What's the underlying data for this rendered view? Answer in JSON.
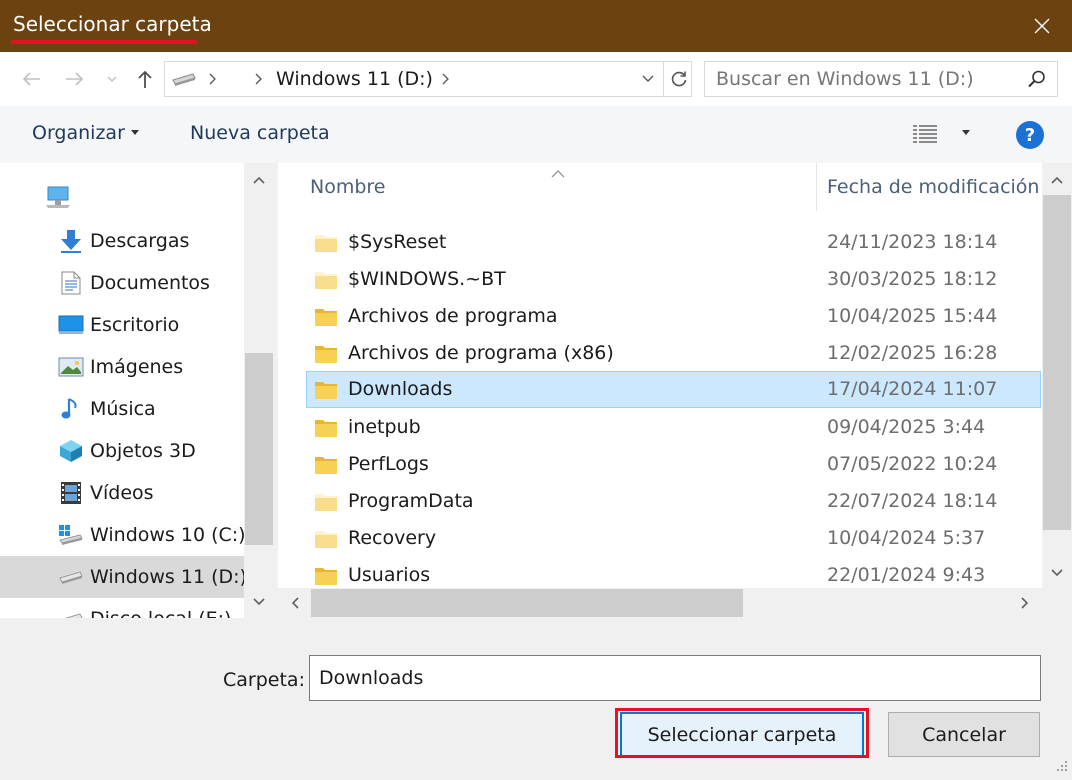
{
  "window": {
    "title": "Seleccionar carpeta"
  },
  "address": {
    "path": "Windows 11 (D:)"
  },
  "search": {
    "placeholder": "Buscar en Windows 11 (D:)"
  },
  "toolbar": {
    "organize_label": "Organizar",
    "new_folder_label": "Nueva carpeta",
    "help_label": "?"
  },
  "nav": {
    "items": [
      {
        "label": "Descargas",
        "icon": "downloads-icon"
      },
      {
        "label": "Documentos",
        "icon": "documents-icon"
      },
      {
        "label": "Escritorio",
        "icon": "desktop-icon"
      },
      {
        "label": "Imágenes",
        "icon": "pictures-icon"
      },
      {
        "label": "Música",
        "icon": "music-icon"
      },
      {
        "label": "Objetos 3D",
        "icon": "3d-objects-icon"
      },
      {
        "label": "Vídeos",
        "icon": "videos-icon"
      },
      {
        "label": "Windows 10 (C:)",
        "icon": "windows-drive-icon"
      },
      {
        "label": "Windows 11 (D:)",
        "icon": "drive-icon",
        "selected": true
      },
      {
        "label": "Disco local (E:)",
        "icon": "drive-icon"
      }
    ]
  },
  "columns": {
    "name": "Nombre",
    "date": "Fecha de modificación"
  },
  "files": [
    {
      "name": "$SysReset",
      "date": "24/11/2023 18:14"
    },
    {
      "name": "$WINDOWS.~BT",
      "date": "30/03/2025 18:12"
    },
    {
      "name": "Archivos de programa",
      "date": "10/04/2025 15:44"
    },
    {
      "name": "Archivos de programa (x86)",
      "date": "12/02/2025 16:28"
    },
    {
      "name": "Downloads",
      "date": "17/04/2024 11:07",
      "selected": true
    },
    {
      "name": "inetpub",
      "date": "09/04/2025 3:44"
    },
    {
      "name": "PerfLogs",
      "date": "07/05/2022 10:24"
    },
    {
      "name": "ProgramData",
      "date": "22/07/2024 18:14"
    },
    {
      "name": "Recovery",
      "date": "10/04/2024 5:37"
    },
    {
      "name": "Usuarios",
      "date": "22/01/2024 9:43"
    }
  ],
  "footer": {
    "folder_label": "Carpeta:",
    "folder_value": "Downloads",
    "select_label": "Seleccionar carpeta",
    "cancel_label": "Cancelar"
  },
  "colors": {
    "titlebar": "#6b4210",
    "accent": "#0078d7",
    "highlight": "#e81123",
    "selection": "#cce8ff"
  }
}
